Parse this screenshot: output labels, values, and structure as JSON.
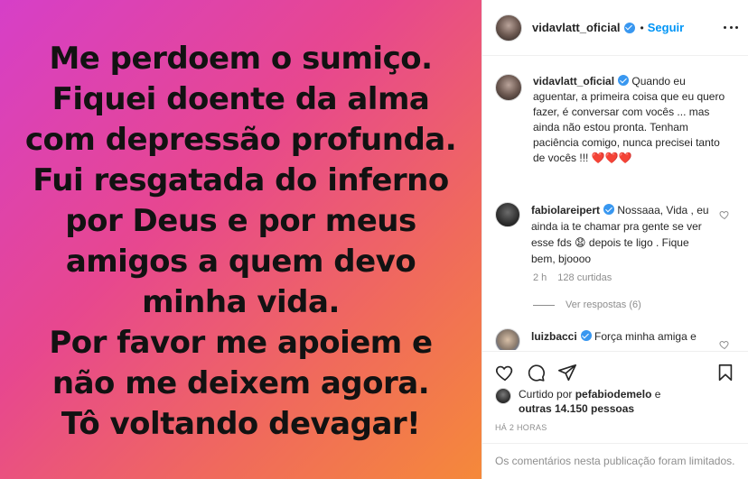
{
  "media": {
    "lines": [
      "Me perdoem o sumiço.",
      "Fiquei doente da alma",
      "com depressão profunda.",
      "Fui resgatada do inferno",
      "por Deus e por meus",
      "amigos a quem devo",
      "minha vida.",
      "Por favor me apoiem e",
      "não me deixem agora.",
      "Tô voltando devagar!"
    ]
  },
  "header": {
    "username": "vidavlatt_oficial",
    "separator": "•",
    "follow_label": "Seguir"
  },
  "caption": {
    "username": "vidavlatt_oficial",
    "text": "Quando eu aguentar, a primeira coisa que eu quero fazer, é conversar com vocês ... mas ainda não estou pronta. Tenham paciência comigo, nunca precisei tanto de vocês !!!",
    "emoji": "❤️❤️❤️"
  },
  "comment1": {
    "username": "fabiolareipert",
    "text": "Nossaaa, Vida , eu ainda ia te chamar pra gente se ver esse fds",
    "emoji": "😧",
    "text2": "depois te ligo . Fique bem, bjoooo",
    "time": "2 h",
    "likes": "128 curtidas",
    "view_replies": "Ver respostas (6)"
  },
  "comment2": {
    "username": "luizbacci",
    "text": "Força minha amiga e"
  },
  "likes": {
    "prefix": "Curtido por",
    "user": "pefabiodemelo",
    "joiner": "e",
    "others": "outras 14.150 pessoas"
  },
  "time_ago": "HÁ 2 HORAS",
  "limited_text": "Os comentários nesta publicação foram limitados.",
  "icons": {
    "like": "heart-outline-icon",
    "comment": "comment-bubble-icon",
    "share": "paper-plane-icon",
    "save": "bookmark-icon",
    "more": "ellipsis-icon"
  },
  "colors": {
    "link_blue": "#0095f6",
    "verified_blue": "#3897f0",
    "gradient_start": "#d63fc8",
    "gradient_end": "#f5893a"
  }
}
